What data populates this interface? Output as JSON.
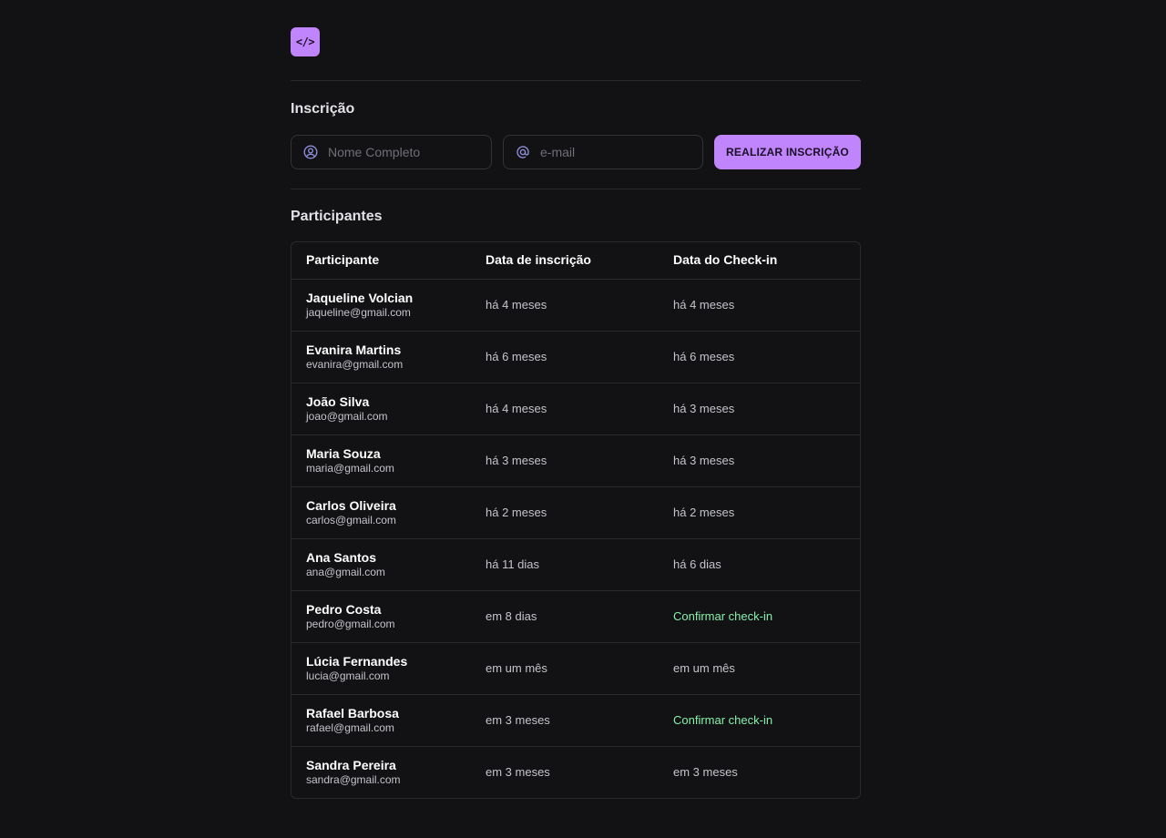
{
  "logo": {
    "icon": "code-brackets-icon",
    "text": "</>",
    "color": "#c084fc"
  },
  "registration": {
    "title": "Inscrição",
    "name_placeholder": "Nome Completo",
    "name_value": "",
    "email_placeholder": "e-mail",
    "email_value": "",
    "submit_label": "REALIZAR INSCRIÇÃO"
  },
  "participants": {
    "title": "Participantes",
    "columns": [
      "Participante",
      "Data de inscrição",
      "Data do Check-in"
    ],
    "rows": [
      {
        "name": "Jaqueline Volcian",
        "email": "jaqueline@gmail.com",
        "registered": "há 4 meses",
        "checkin": "há 4 meses",
        "checked": true
      },
      {
        "name": "Evanira Martins",
        "email": "evanira@gmail.com",
        "registered": "há 6 meses",
        "checkin": "há 6 meses",
        "checked": true
      },
      {
        "name": "João Silva",
        "email": "joao@gmail.com",
        "registered": "há 4 meses",
        "checkin": "há 3 meses",
        "checked": true
      },
      {
        "name": "Maria Souza",
        "email": "maria@gmail.com",
        "registered": "há 3 meses",
        "checkin": "há 3 meses",
        "checked": true
      },
      {
        "name": "Carlos Oliveira",
        "email": "carlos@gmail.com",
        "registered": "há 2 meses",
        "checkin": "há 2 meses",
        "checked": true
      },
      {
        "name": "Ana Santos",
        "email": "ana@gmail.com",
        "registered": "há 11 dias",
        "checkin": "há 6 dias",
        "checked": true
      },
      {
        "name": "Pedro Costa",
        "email": "pedro@gmail.com",
        "registered": "em 8 dias",
        "checkin": "Confirmar check-in",
        "checked": false
      },
      {
        "name": "Lúcia Fernandes",
        "email": "lucia@gmail.com",
        "registered": "em um mês",
        "checkin": "em um mês",
        "checked": true
      },
      {
        "name": "Rafael Barbosa",
        "email": "rafael@gmail.com",
        "registered": "em 3 meses",
        "checkin": "Confirmar check-in",
        "checked": false
      },
      {
        "name": "Sandra Pereira",
        "email": "sandra@gmail.com",
        "registered": "em 3 meses",
        "checkin": "em 3 meses",
        "checked": true
      }
    ]
  },
  "colors": {
    "background": "#121214",
    "accent": "#c084fc",
    "checkin_link": "#86efac",
    "border": "#29292e"
  }
}
